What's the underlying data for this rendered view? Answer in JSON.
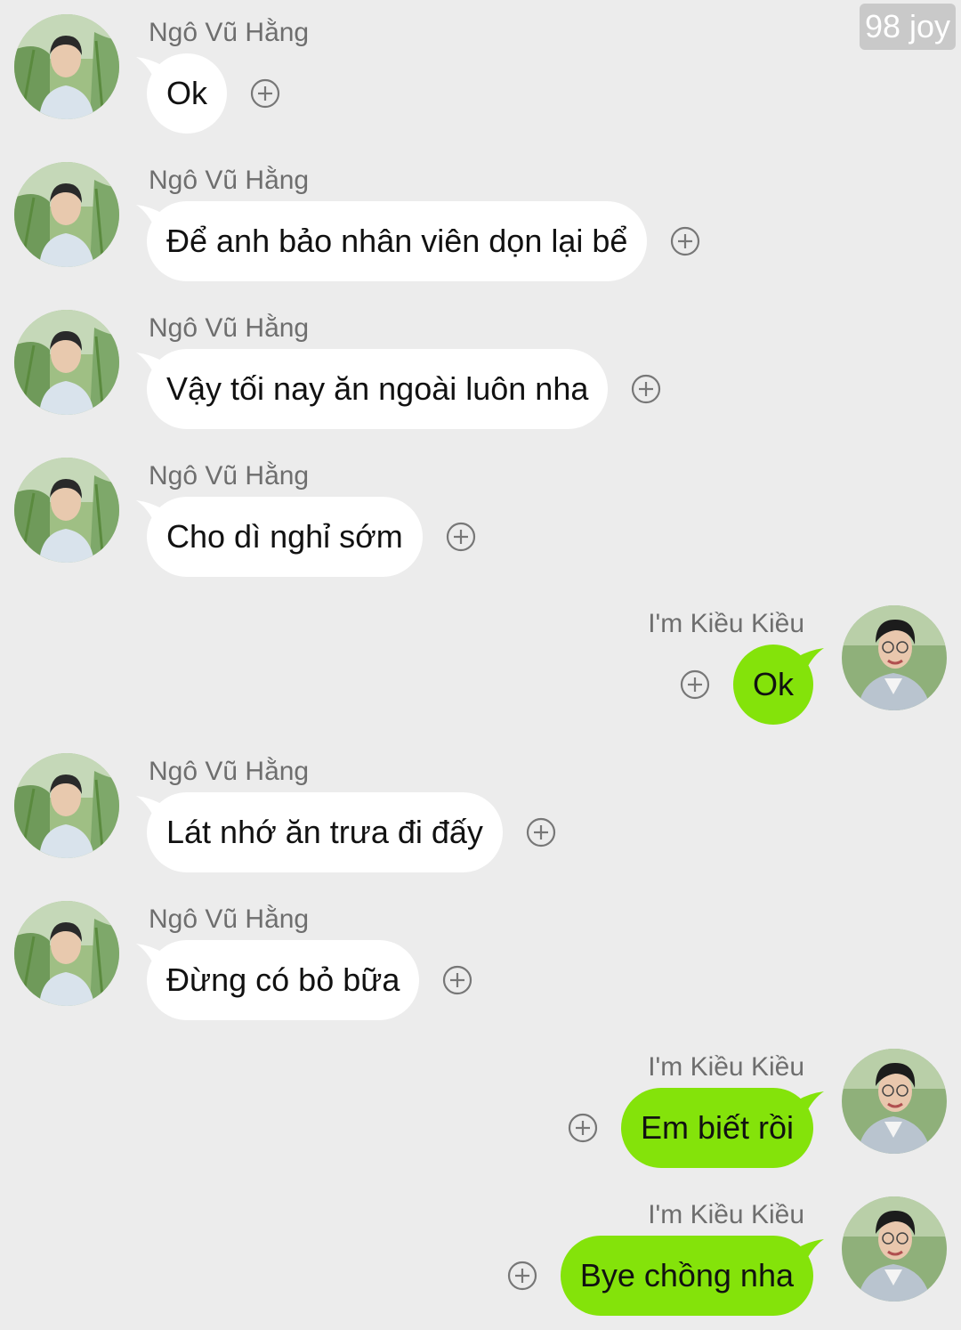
{
  "watermark": "98 joy",
  "colors": {
    "background": "#ececec",
    "incoming_bubble": "#ffffff",
    "outgoing_bubble": "#84e30a",
    "sender_name": "#6e6e6e"
  },
  "icons": {
    "react": "circle-plus-icon",
    "avatar": "profile-photo"
  },
  "messages": [
    {
      "side": "left",
      "sender": "Ngô Vũ Hằng",
      "text": "Ok"
    },
    {
      "side": "left",
      "sender": "Ngô Vũ Hằng",
      "text": "Để anh bảo nhân viên dọn lại bể"
    },
    {
      "side": "left",
      "sender": "Ngô Vũ Hằng",
      "text": "Vậy tối nay ăn ngoài luôn nha"
    },
    {
      "side": "left",
      "sender": "Ngô Vũ Hằng",
      "text": "Cho dì nghỉ sớm"
    },
    {
      "side": "right",
      "sender": "I'm Kiều Kiều",
      "text": "Ok"
    },
    {
      "side": "left",
      "sender": "Ngô Vũ Hằng",
      "text": "Lát nhớ ăn trưa đi đấy"
    },
    {
      "side": "left",
      "sender": "Ngô Vũ Hằng",
      "text": "Đừng có bỏ bữa"
    },
    {
      "side": "right",
      "sender": "I'm Kiều Kiều",
      "text": "Em biết rồi"
    },
    {
      "side": "right",
      "sender": "I'm Kiều Kiều",
      "text": "Bye chồng nha"
    }
  ]
}
